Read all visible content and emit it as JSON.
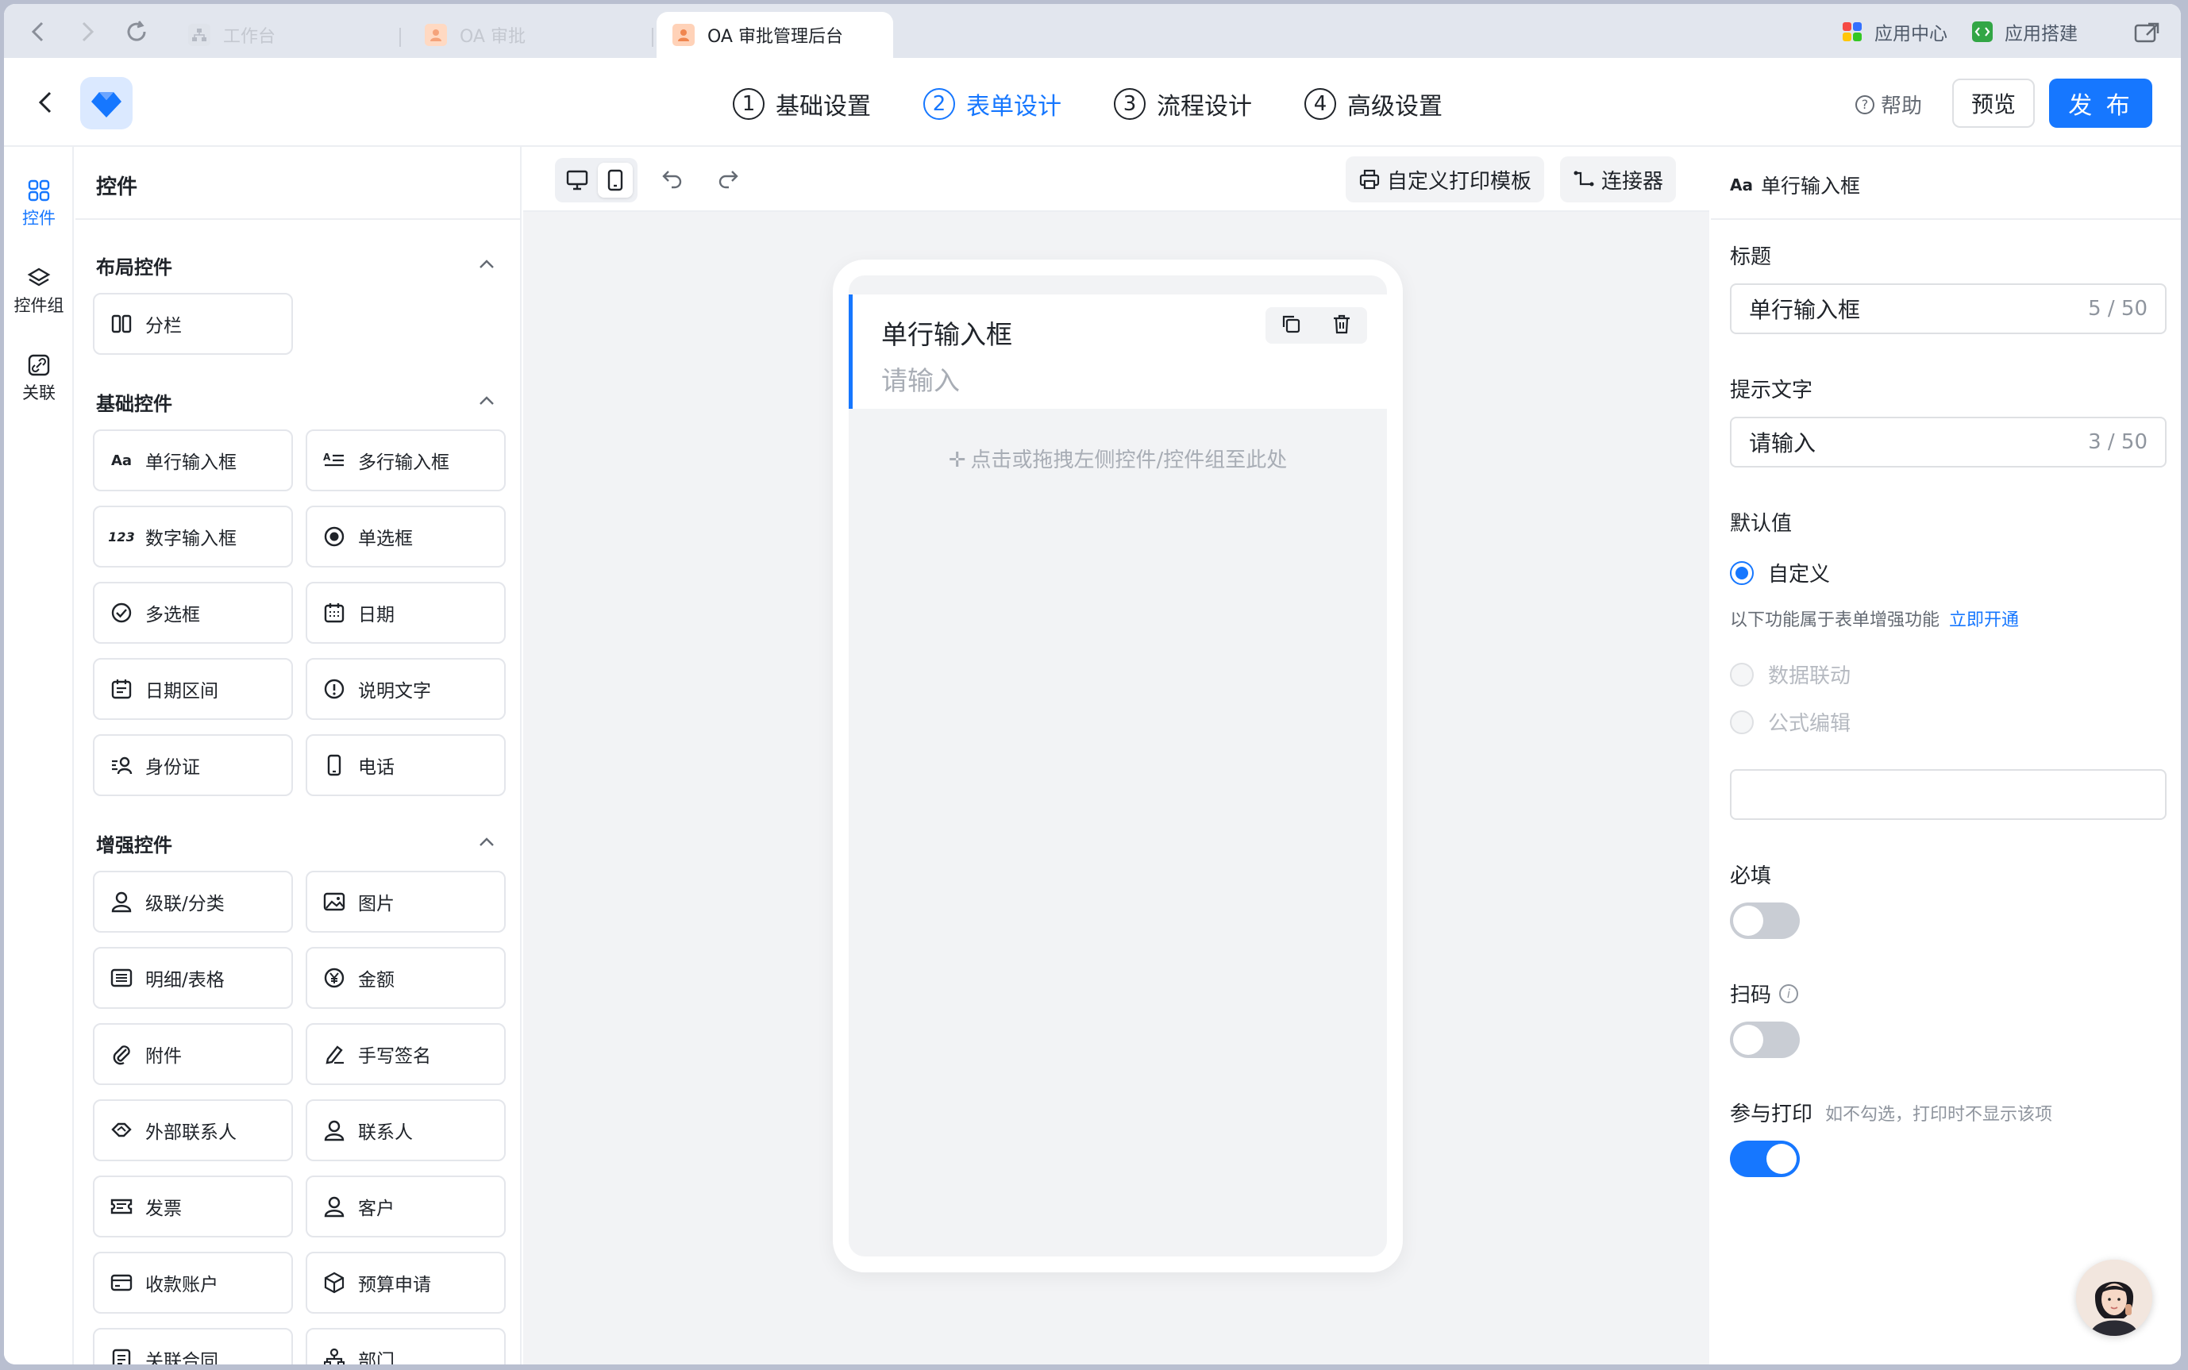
{
  "browser": {
    "tabs": [
      {
        "label": "工作台",
        "active": false
      },
      {
        "label": "OA 审批",
        "active": false
      },
      {
        "label": "OA 审批管理后台",
        "active": true
      }
    ],
    "menu": {
      "app_center": "应用中心",
      "app_builder": "应用搭建"
    }
  },
  "header": {
    "steps": [
      {
        "num": "1",
        "label": "基础设置"
      },
      {
        "num": "2",
        "label": "表单设计"
      },
      {
        "num": "3",
        "label": "流程设计"
      },
      {
        "num": "4",
        "label": "高级设置"
      }
    ],
    "help": "帮助",
    "preview": "预览",
    "publish": "发 布"
  },
  "rail": {
    "items": [
      "控件",
      "控件组",
      "关联"
    ]
  },
  "panel": {
    "title": "控件",
    "sections": [
      {
        "title": "布局控件",
        "items": [
          "分栏"
        ]
      },
      {
        "title": "基础控件",
        "items": [
          "单行输入框",
          "多行输入框",
          "数字输入框",
          "单选框",
          "多选框",
          "日期",
          "日期区间",
          "说明文字",
          "身份证",
          "电话"
        ]
      },
      {
        "title": "增强控件",
        "items": [
          "级联/分类",
          "图片",
          "明细/表格",
          "金额",
          "附件",
          "手写签名",
          "外部联系人",
          "联系人",
          "发票",
          "客户",
          "收款账户",
          "预算申请",
          "关联合同",
          "部门"
        ]
      }
    ]
  },
  "canvas": {
    "toolbar": {
      "print_template": "自定义打印模板",
      "connector": "连接器"
    },
    "field": {
      "label": "单行输入框",
      "placeholder": "请输入"
    },
    "drop_hint": "点击或拖拽左侧控件/控件组至此处"
  },
  "props": {
    "header": "单行输入框",
    "title_label": "标题",
    "title_value": "单行输入框",
    "title_count": "5 / 50",
    "hint_label": "提示文字",
    "hint_value": "请输入",
    "hint_count": "3 / 50",
    "default_label": "默认值",
    "default_custom": "自定义",
    "enhance_note": "以下功能属于表单增强功能",
    "enhance_link": "立即开通",
    "data_link": "数据联动",
    "formula": "公式编辑",
    "required_label": "必填",
    "scan_label": "扫码",
    "print_label": "参与打印",
    "print_note": "如不勾选，打印时不显示该项",
    "required_on": false,
    "scan_on": false,
    "print_on": true
  },
  "colors": {
    "accent": "#1677ff"
  }
}
